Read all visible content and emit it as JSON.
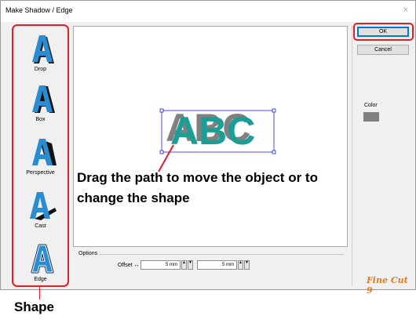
{
  "window": {
    "title": "Make Shadow / Edge",
    "close_glyph": "×"
  },
  "shapes": [
    {
      "label": "Drop",
      "icon": "drop-shadow-a-icon"
    },
    {
      "label": "Box",
      "icon": "box-shadow-a-icon"
    },
    {
      "label": "Perspective",
      "icon": "perspective-shadow-a-icon"
    },
    {
      "label": "Cast",
      "icon": "cast-shadow-a-icon"
    },
    {
      "label": "Edge",
      "icon": "edge-a-icon"
    }
  ],
  "canvas": {
    "preview_text": "ABC",
    "annotation": "Drag the path to move the object or to change the shape",
    "text_color": "#1a9e96",
    "shadow_color": "#808080"
  },
  "options": {
    "title": "Options",
    "offset_label": "Offset",
    "horizontal_glyph": "↔",
    "vertical_glyph": "↕",
    "offset_x": "5 mm",
    "offset_y": "5 mm"
  },
  "buttons": {
    "ok": "OK",
    "cancel": "Cancel"
  },
  "color": {
    "label": "Color",
    "value": "#7f7f7f"
  },
  "logo": "Fine Cut 9",
  "caption_shape": "Shape",
  "highlight_color": "#e21e26"
}
